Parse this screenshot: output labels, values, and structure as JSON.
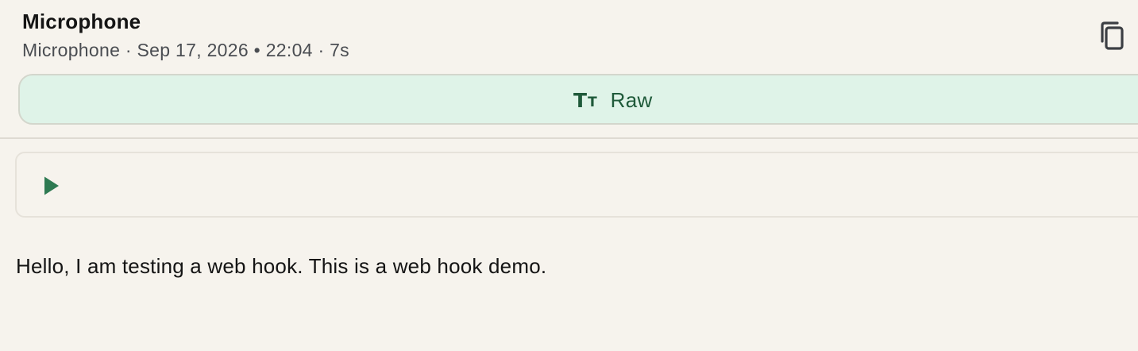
{
  "header": {
    "title": "Microphone",
    "meta": "Microphone · Sep 17, 2026 • 22:04 · 7s"
  },
  "toolbar": {
    "copy_icon": "copy-icon",
    "raw_icon": "text-size-icon",
    "raw_label": "Raw"
  },
  "player": {
    "play_icon": "play-icon"
  },
  "transcript": {
    "text": "Hello, I am testing a web hook. This is a web hook demo."
  },
  "colors": {
    "background": "#f6f3ed",
    "accent_green": "#1f5a3a",
    "raw_bg": "#dff3e8",
    "play_green": "#2e7a52",
    "meta_text": "#4a4d52"
  }
}
